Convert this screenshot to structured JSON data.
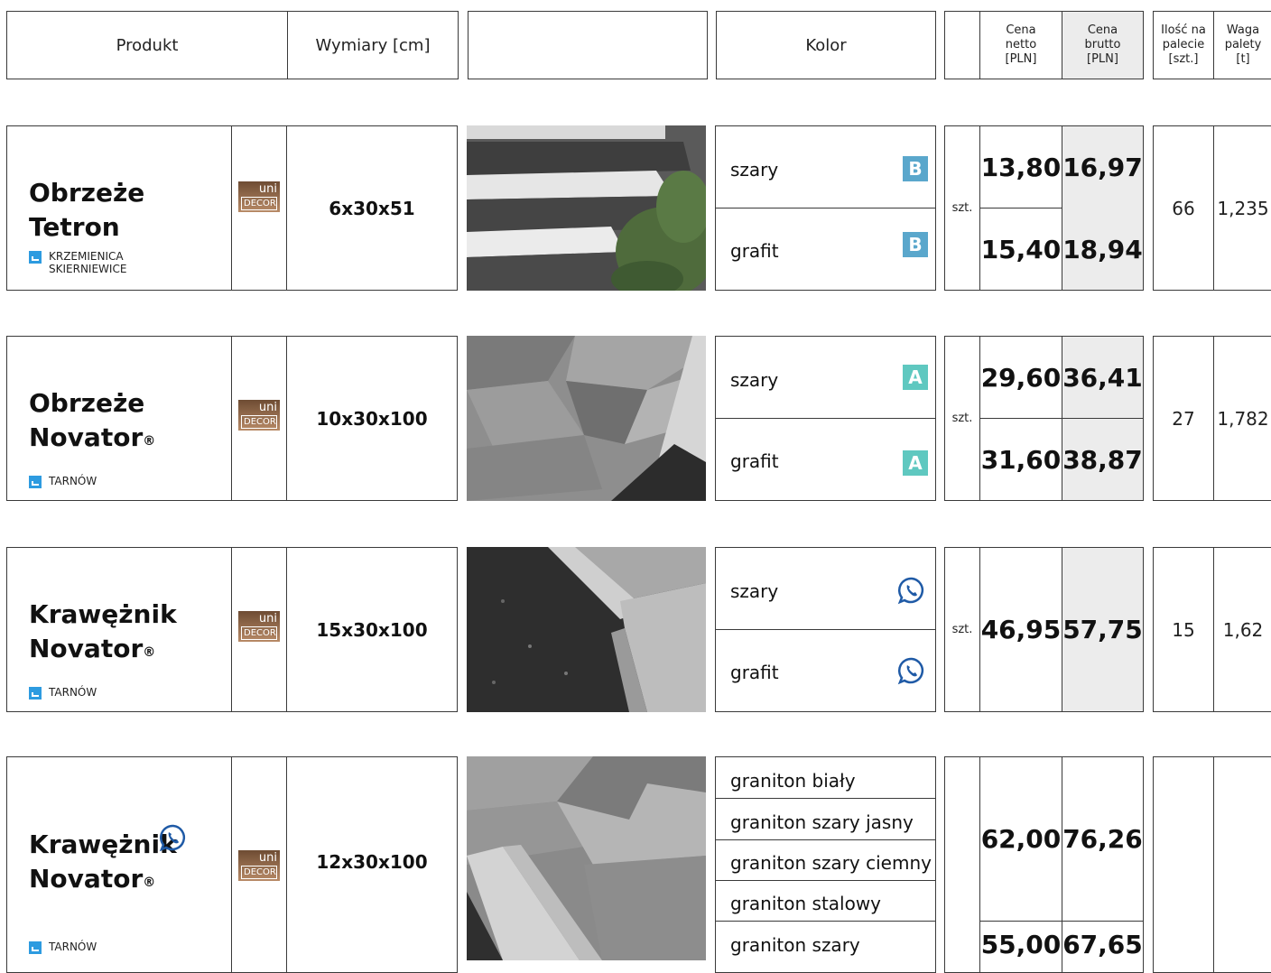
{
  "header": {
    "produkt": "Produkt",
    "wymiary": "Wymiary [cm]",
    "kolor": "Kolor",
    "cena_netto": [
      "Cena",
      "netto",
      "[PLN]"
    ],
    "cena_brutto": [
      "Cena",
      "brutto",
      "[PLN]"
    ],
    "ilosc": [
      "Ilość na",
      "palecie",
      "[szt.]"
    ],
    "waga": [
      "Waga",
      "palety",
      "[t]"
    ]
  },
  "logo": {
    "line1": "uni",
    "line2": "DECOR"
  },
  "rows": [
    {
      "name_line1": "Obrzeże",
      "name_line2": "Tetron",
      "name_sup": "",
      "plant_line1": "KRZEMIENICA",
      "plant_line2": "SKIERNIEWICE",
      "dims": "6x30x51",
      "colors": [
        {
          "name": "szary",
          "badge": "B"
        },
        {
          "name": "grafit",
          "badge": "B"
        }
      ],
      "unit": "szt.",
      "prices": [
        {
          "netto": "13,80",
          "brutto": "16,97"
        },
        {
          "netto": "15,40",
          "brutto": "18,94"
        }
      ],
      "ilosc": "66",
      "waga": "1,235"
    },
    {
      "name_line1": "Obrzeże",
      "name_line2": "Novator",
      "name_sup": "®",
      "plant_line1": "TARNÓW",
      "plant_line2": "",
      "dims": "10x30x100",
      "colors": [
        {
          "name": "szary",
          "badge": "A"
        },
        {
          "name": "grafit",
          "badge": "A"
        }
      ],
      "unit": "szt.",
      "prices": [
        {
          "netto": "29,60",
          "brutto": "36,41"
        },
        {
          "netto": "31,60",
          "brutto": "38,87"
        }
      ],
      "ilosc": "27",
      "waga": "1,782"
    },
    {
      "name_line1": "Krawężnik",
      "name_line2": "Novator",
      "name_sup": "®",
      "plant_line1": "TARNÓW",
      "plant_line2": "",
      "dims": "15x30x100",
      "colors": [
        {
          "name": "szary",
          "badge": "whatsapp"
        },
        {
          "name": "grafit",
          "badge": "whatsapp"
        }
      ],
      "unit": "szt.",
      "prices": [
        {
          "netto": "46,95",
          "brutto": "57,75"
        }
      ],
      "ilosc": "15",
      "waga": "1,62"
    },
    {
      "name_line1": "Krawężnik",
      "name_line2": "Novator",
      "name_sup": "®",
      "plant_line1": "TARNÓW",
      "plant_line2": "",
      "dims": "12x30x100",
      "colors": [
        {
          "name": "graniton biały"
        },
        {
          "name": "graniton szary jasny"
        },
        {
          "name": "graniton szary ciemny"
        },
        {
          "name": "graniton stalowy"
        },
        {
          "name": "graniton szary"
        }
      ],
      "unit": "",
      "prices": [
        {
          "netto": "62,00",
          "brutto": "76,26"
        },
        {
          "netto": "55,00",
          "brutto": "67,65"
        }
      ],
      "ilosc": "",
      "waga": ""
    }
  ],
  "colors": {
    "border": "#3a3a3a",
    "badgeA": "#5fc8c0",
    "badgeB": "#5aa7cc",
    "whatsapp": "#1f5aa6",
    "plant_icon": "#2d9be0",
    "brutto_bg": "#ececec"
  },
  "icons": {
    "plant": "factory-icon",
    "messenger": "whatsapp-icon",
    "logo": "unidecor-logo"
  }
}
